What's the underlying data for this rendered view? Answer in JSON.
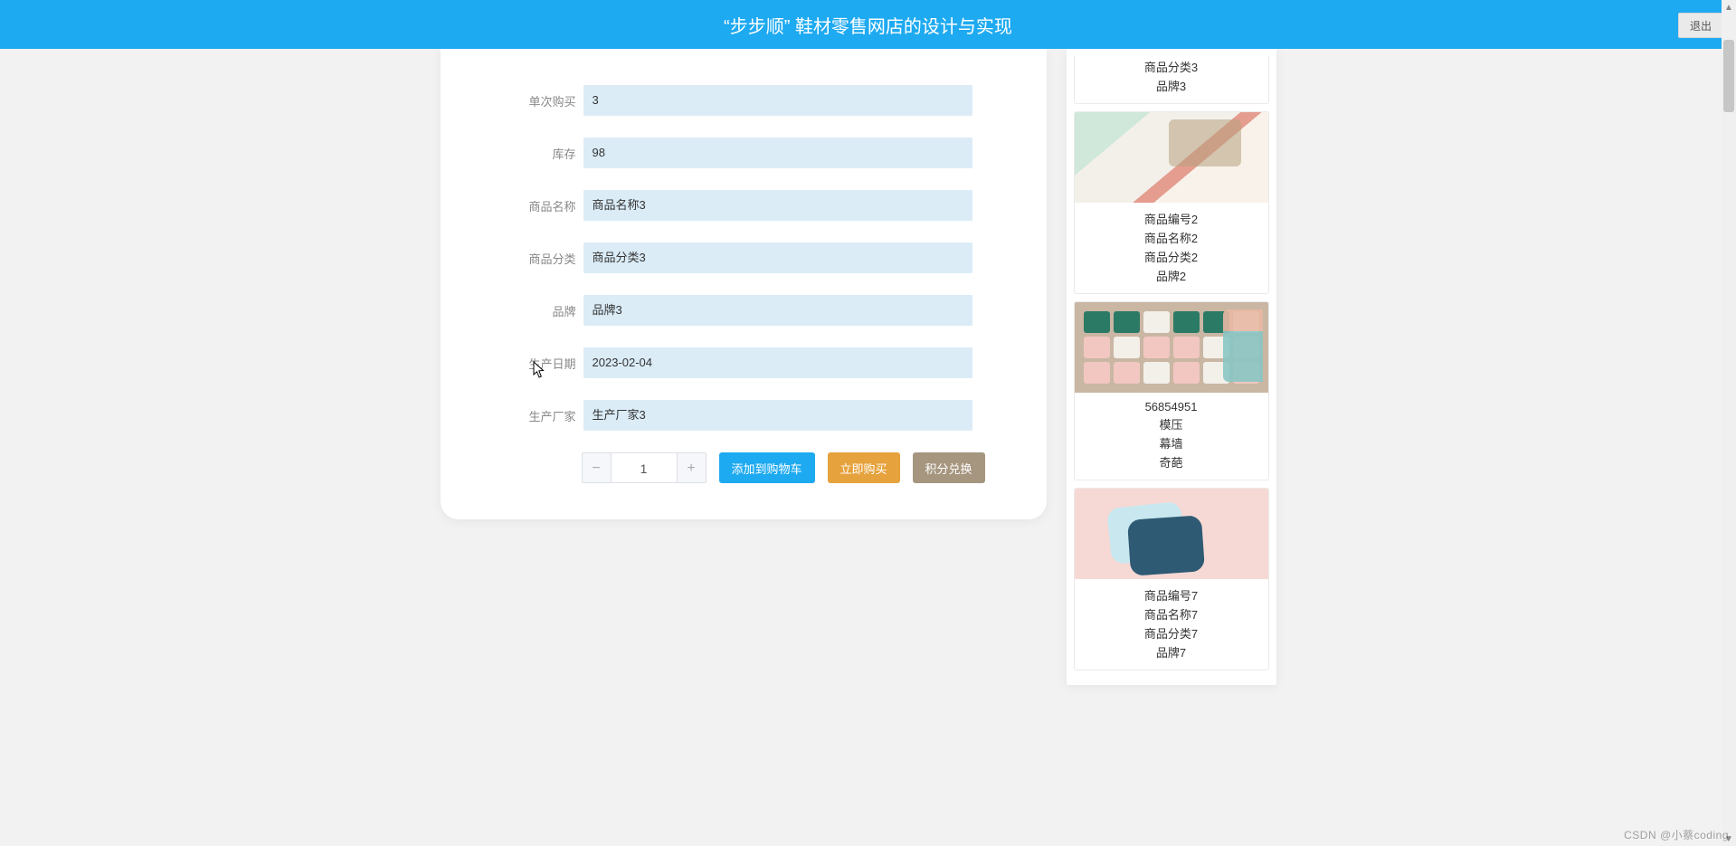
{
  "header": {
    "title": "“步步顺” 鞋材零售网店的设计与实现",
    "logout_label": "退出"
  },
  "form": {
    "fields": [
      {
        "label": "单次购买",
        "value": "3"
      },
      {
        "label": "库存",
        "value": "98"
      },
      {
        "label": "商品名称",
        "value": "商品名称3"
      },
      {
        "label": "商品分类",
        "value": "商品分类3"
      },
      {
        "label": "品牌",
        "value": "品牌3"
      },
      {
        "label": "生产日期",
        "value": "2023-02-04"
      },
      {
        "label": "生产厂家",
        "value": "生产厂家3"
      }
    ]
  },
  "actions": {
    "quantity": "1",
    "add_to_cart": "添加到购物车",
    "buy_now": "立即购买",
    "points_redeem": "积分兑换"
  },
  "sidebar": {
    "items": [
      {
        "truncated": true,
        "image_class": "none",
        "lines": [
          "商品分类3",
          "品牌3"
        ]
      },
      {
        "image_class": "img-towel",
        "lines": [
          "商品编号2",
          "商品名称2",
          "商品分类2",
          "品牌2"
        ]
      },
      {
        "image_class": "img-shoes",
        "lines": [
          "56854951",
          "模压",
          "幕墙",
          "奇葩"
        ]
      },
      {
        "image_class": "img-tray",
        "lines": [
          "商品编号7",
          "商品名称7",
          "商品分类7",
          "品牌7"
        ]
      }
    ]
  },
  "watermark": "CSDN @小蔡coding"
}
